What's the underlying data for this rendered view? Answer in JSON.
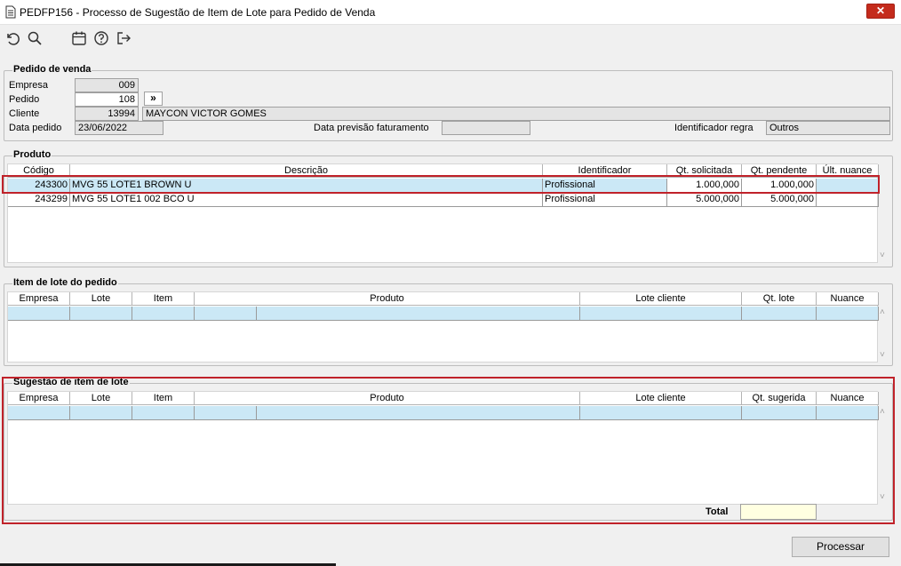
{
  "window": {
    "title": "PEDFP156 - Processo de Sugestão de Item de Lote para Pedido de Venda",
    "close_glyph": "✕"
  },
  "toolbar": {
    "icons": [
      "undo-icon",
      "search-icon",
      "calendar-icon",
      "help-icon",
      "exit-icon"
    ]
  },
  "pedido": {
    "section_title": "Pedido de venda",
    "empresa_label": "Empresa",
    "empresa_value": "009",
    "pedido_label": "Pedido",
    "pedido_value": "108",
    "expand_glyph": "»",
    "cliente_label": "Cliente",
    "cliente_code": "13994",
    "cliente_name": "MAYCON VICTOR GOMES",
    "data_pedido_label": "Data pedido",
    "data_pedido_value": "23/06/2022",
    "data_previsao_label": "Data previsão faturamento",
    "data_previsao_value": "",
    "identificador_label": "Identificador regra",
    "identificador_value": "Outros"
  },
  "produto": {
    "section_title": "Produto",
    "columns": [
      "Código",
      "Descrição",
      "Identificador",
      "Qt. solicitada",
      "Qt. pendente",
      "Últ. nuance"
    ],
    "rows": [
      [
        "243300",
        "MVG 55 LOTE1 BROWN U",
        "Profissional",
        "1.000,000",
        "1.000,000",
        ""
      ],
      [
        "243299",
        "MVG 55 LOTE1 002 BCO U",
        "Profissional",
        "5.000,000",
        "5.000,000",
        ""
      ]
    ]
  },
  "item_lote": {
    "section_title": "Item de lote do pedido",
    "columns": [
      "Empresa",
      "Lote",
      "Item",
      "Produto",
      "Lote cliente",
      "Qt. lote",
      "Nuance"
    ]
  },
  "sugestao": {
    "section_title": "Sugestão de item de lote",
    "columns": [
      "Empresa",
      "Lote",
      "Item",
      "Produto",
      "Lote cliente",
      "Qt. sugerida",
      "Nuance"
    ],
    "total_label": "Total",
    "total_value": ""
  },
  "actions": {
    "processar_label": "Processar"
  },
  "colors": {
    "highlight_red": "#c0222a",
    "row_blue": "#cbe8f6",
    "close_red": "#c42b1c"
  }
}
